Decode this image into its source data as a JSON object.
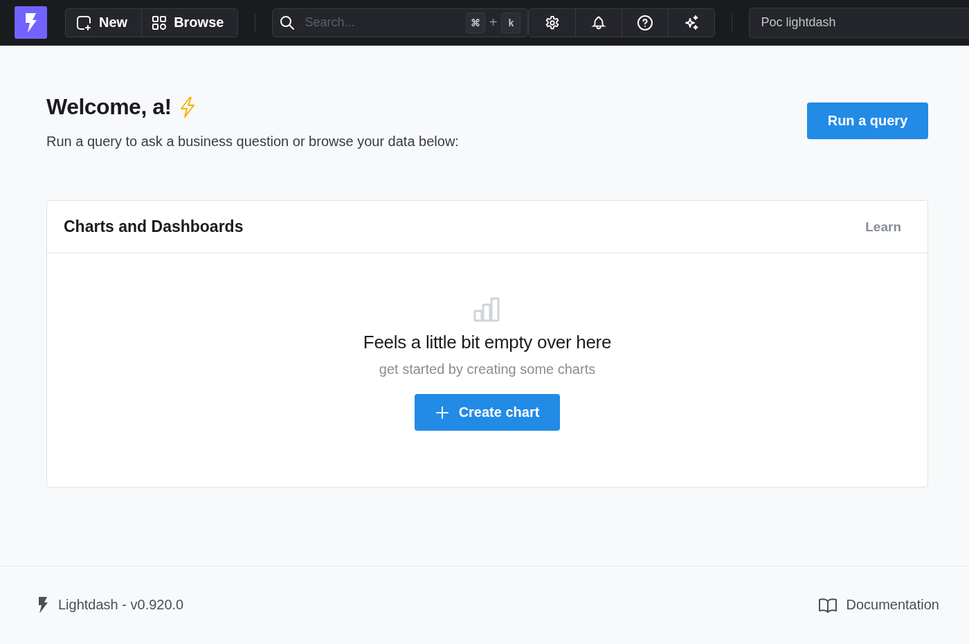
{
  "header": {
    "new_button": "New",
    "browse_button": "Browse",
    "search": {
      "placeholder": "Search...",
      "shortcut_keys": [
        "⌘",
        "+",
        "k"
      ]
    },
    "project": "Poc lightdash"
  },
  "welcome": {
    "title": "Welcome, a!",
    "subtitle": "Run a query to ask a business question or browse your data below:",
    "action": "Run a query"
  },
  "card": {
    "title": "Charts and Dashboards",
    "link": "Learn",
    "empty_title": "Feels a little bit empty over here",
    "empty_subtitle": "get started by creating some charts",
    "action": "Create chart"
  },
  "footer": {
    "version": "Lightdash - v0.920.0",
    "docs": "Documentation"
  }
}
